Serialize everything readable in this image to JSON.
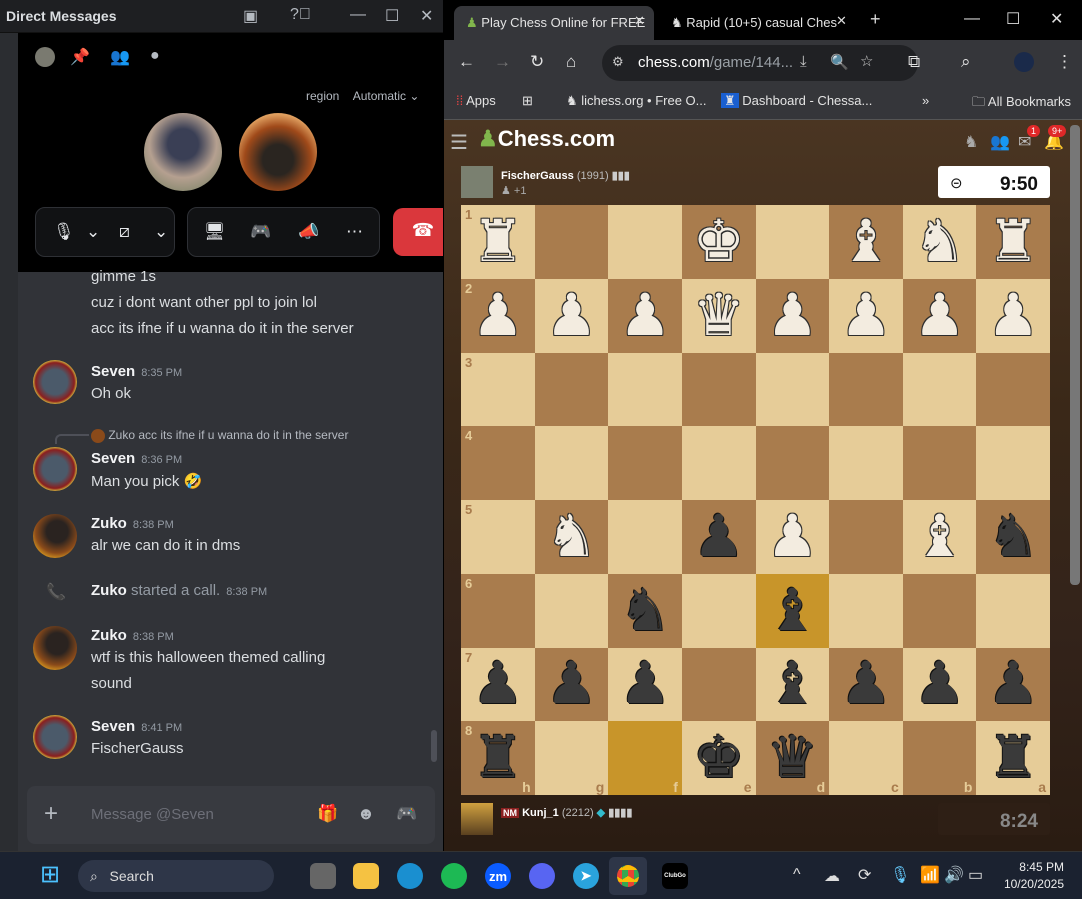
{
  "discord": {
    "title": "Direct Messages",
    "search_placeholder": "Search",
    "region_label": "region",
    "region_value": "Automatic",
    "partial_messages": [
      "gimme 1s",
      "cuz i dont want other ppl to join lol",
      "acc its ifne if u wanna do it in the server"
    ],
    "messages": [
      {
        "author": "Seven",
        "time": "8:35 PM",
        "lines": [
          "Oh ok"
        ]
      },
      {
        "reply_author": "Zuko",
        "reply_text": "acc its ifne if u wanna do it in the server",
        "author": "Seven",
        "time": "8:36 PM",
        "lines": [
          "Man you pick 🤣"
        ]
      },
      {
        "author": "Zuko",
        "time": "8:38 PM",
        "lines": [
          "alr we can do it in dms"
        ]
      },
      {
        "system_author": "Zuko",
        "system_text": "started a call.",
        "time": "8:38 PM"
      },
      {
        "author": "Zuko",
        "time": "8:38 PM",
        "lines": [
          "wtf is this halloween themed calling",
          "sound"
        ]
      },
      {
        "author": "Seven",
        "time": "8:41 PM",
        "lines": [
          "FischerGauss"
        ]
      }
    ],
    "message_placeholder": "Message @Seven"
  },
  "chrome": {
    "tabs": [
      {
        "label": "Play Chess Online for FREE"
      },
      {
        "label": "Rapid (10+5) casual Ches"
      }
    ],
    "url_host": "chess.com",
    "url_path": "/game/144...",
    "bookmarks": [
      "Apps",
      "lichess.org • Free O...",
      "Dashboard - Chessa..."
    ],
    "all_bookmarks": "All Bookmarks",
    "overflow": "»"
  },
  "chess": {
    "logo": "Chess.com",
    "mail_badge": "1",
    "notif_badge": "9+",
    "top_player": {
      "name": "FischerGauss",
      "rating": "(1991)",
      "material": "+1",
      "clock": "9:50"
    },
    "bottom_player": {
      "title": "NM",
      "name": "Kunj_1",
      "rating": "(2212)",
      "clock": "8:24"
    },
    "ranks": [
      "1",
      "2",
      "3",
      "4",
      "5",
      "6",
      "7",
      "8"
    ],
    "files": [
      "h",
      "g",
      "f",
      "e",
      "d",
      "c",
      "b",
      "a"
    ],
    "board": [
      [
        "wR",
        "",
        "",
        "wK",
        "",
        "wB",
        "wN",
        "wR"
      ],
      [
        "wP",
        "wP",
        "wP",
        "wQ",
        "wP",
        "wP",
        "wP",
        "wP"
      ],
      [
        "",
        "",
        "",
        "",
        "",
        "",
        "",
        ""
      ],
      [
        "",
        "",
        "",
        "",
        "",
        "",
        "",
        ""
      ],
      [
        "",
        "wN",
        "",
        "bP",
        "wP",
        "",
        "wB",
        "bN"
      ],
      [
        "",
        "",
        "bN",
        "",
        "bB",
        "",
        "",
        ""
      ],
      [
        "bP",
        "bP",
        "bP",
        "",
        "bB",
        "bP",
        "bP",
        "bP"
      ],
      [
        "bR",
        "",
        "",
        "bK",
        "bQ",
        "",
        "",
        "bR"
      ]
    ],
    "highlighted": [
      "f8",
      "d6"
    ]
  },
  "taskbar": {
    "search": "Search",
    "time": "8:45 PM",
    "date": "10/20/2025",
    "clubgo": "ClubGo"
  }
}
